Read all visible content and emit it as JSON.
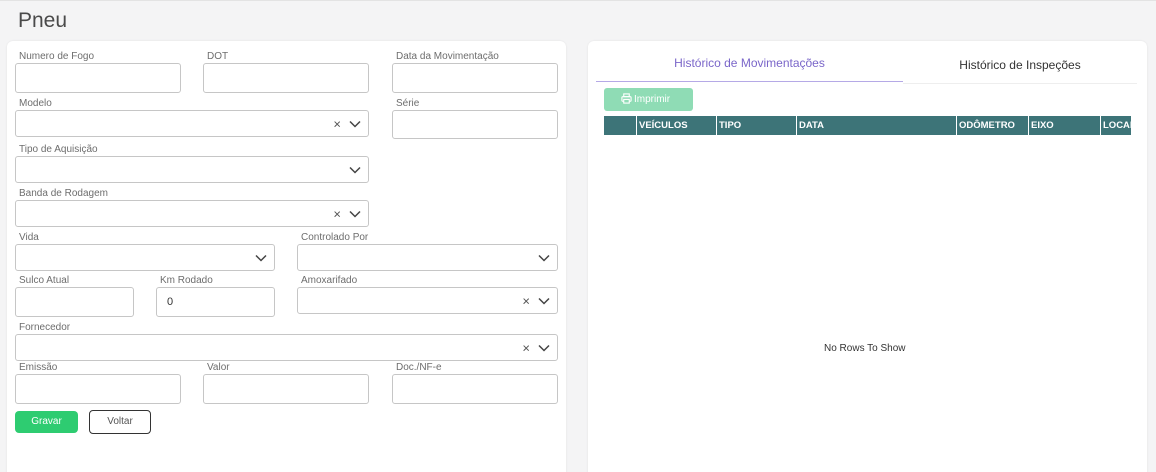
{
  "page": {
    "title": "Pneu"
  },
  "form": {
    "numero_fogo": {
      "label": "Numero de Fogo",
      "value": ""
    },
    "dot": {
      "label": "DOT",
      "value": ""
    },
    "data_movimentacao": {
      "label": "Data da Movimentação",
      "value": ""
    },
    "modelo": {
      "label": "Modelo",
      "value": ""
    },
    "serie": {
      "label": "Série",
      "value": ""
    },
    "tipo_aquisicao": {
      "label": "Tipo de Aquisição",
      "value": ""
    },
    "banda_rodagem": {
      "label": "Banda de Rodagem",
      "value": ""
    },
    "vida": {
      "label": "Vida",
      "value": ""
    },
    "controlado_por": {
      "label": "Controlado Por",
      "value": ""
    },
    "sulco_atual": {
      "label": "Sulco Atual",
      "value": ""
    },
    "km_rodado": {
      "label": "Km Rodado",
      "value": "0"
    },
    "amoxarifado": {
      "label": "Amoxarifado",
      "value": ""
    },
    "fornecedor": {
      "label": "Fornecedor",
      "value": ""
    },
    "emissao": {
      "label": "Emissão",
      "value": ""
    },
    "valor": {
      "label": "Valor",
      "value": ""
    },
    "doc_nfe": {
      "label": "Doc./NF-e",
      "value": ""
    },
    "clear_icon": "close-icon",
    "dropdown_icon": "chevron-down-icon",
    "buttons": {
      "save": "Gravar",
      "back": "Voltar"
    }
  },
  "history": {
    "tabs": [
      {
        "label": "Histórico de Movimentações",
        "active": true
      },
      {
        "label": "Histórico de Inspeções",
        "active": false
      }
    ],
    "print_button": "Imprimir",
    "print_icon": "printer-icon",
    "columns": [
      "VEÍCULOS",
      "TIPO",
      "DATA",
      "ODÔMETRO",
      "EIXO",
      "LOCAL"
    ],
    "empty_message": "No Rows To Show"
  },
  "colors": {
    "accent_tab": "#7a66c9",
    "save_button": "#2ecc71",
    "print_button": "#8fdcb5",
    "grid_header": "#3d7478"
  }
}
